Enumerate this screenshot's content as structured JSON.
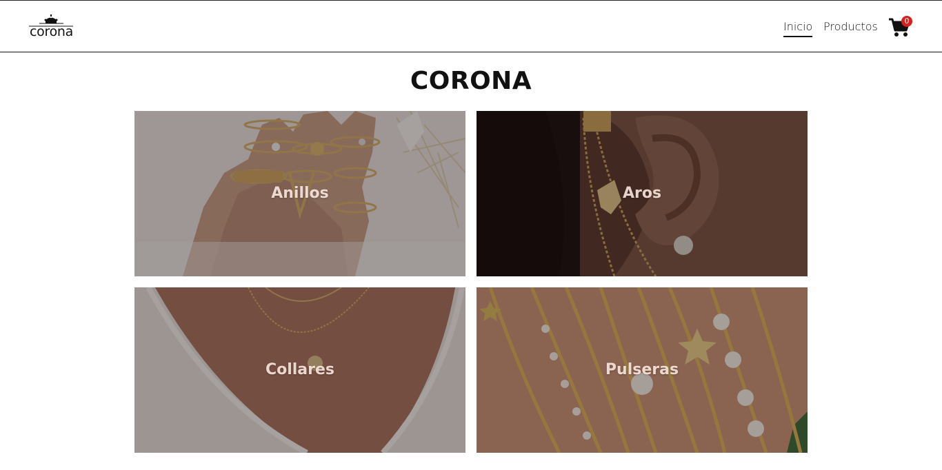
{
  "brand": {
    "name": "corona"
  },
  "nav": {
    "items": [
      {
        "label": "Inicio",
        "active": true
      },
      {
        "label": "Productos",
        "active": false
      }
    ],
    "cart": {
      "count": "0",
      "icon": "cart-icon"
    }
  },
  "main": {
    "title": "CORONA",
    "categories": [
      {
        "label": "Anillos"
      },
      {
        "label": "Aros"
      },
      {
        "label": "Collares"
      },
      {
        "label": "Pulseras"
      }
    ]
  },
  "colors": {
    "text": "#111111",
    "badge": "#d71f1f",
    "overlay": "rgba(20,10,8,0.35)",
    "gold": "#c9a35c"
  }
}
